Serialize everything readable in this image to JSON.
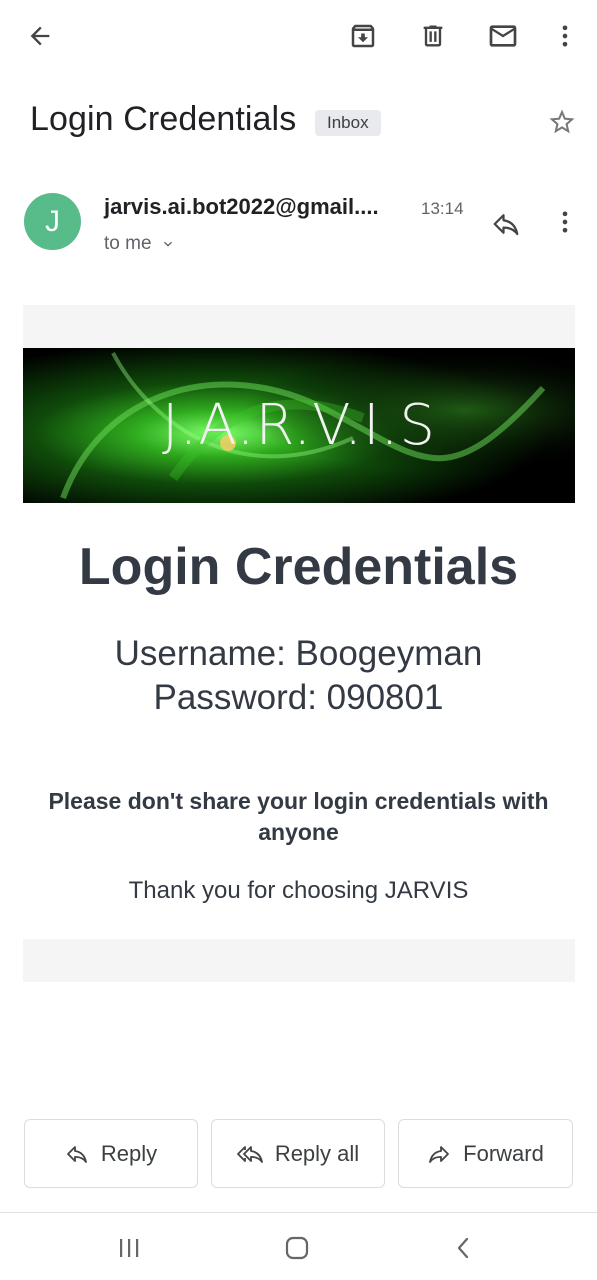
{
  "toolbar": {
    "icons": [
      "back-arrow-icon",
      "archive-icon",
      "trash-icon",
      "mail-icon",
      "more-vert-icon"
    ]
  },
  "email": {
    "subject": "Login Credentials",
    "label": "Inbox",
    "sender_initial": "J",
    "sender": "jarvis.ai.bot2022@gmail....",
    "time": "13:14",
    "recipient": "to me",
    "avatar_color": "#57bb8a"
  },
  "body": {
    "banner_text": "J.A.R.V.I.S",
    "heading": "Login Credentials",
    "username_line": "Username: Boogeyman",
    "password_line": "Password: 090801",
    "warning": "Please don't share your login credentials with anyone",
    "thanks": "Thank you for choosing JARVIS"
  },
  "actions": {
    "reply": "Reply",
    "reply_all": "Reply all",
    "forward": "Forward"
  },
  "navbar": {
    "icons": [
      "recents-icon",
      "home-icon",
      "back-icon"
    ]
  }
}
